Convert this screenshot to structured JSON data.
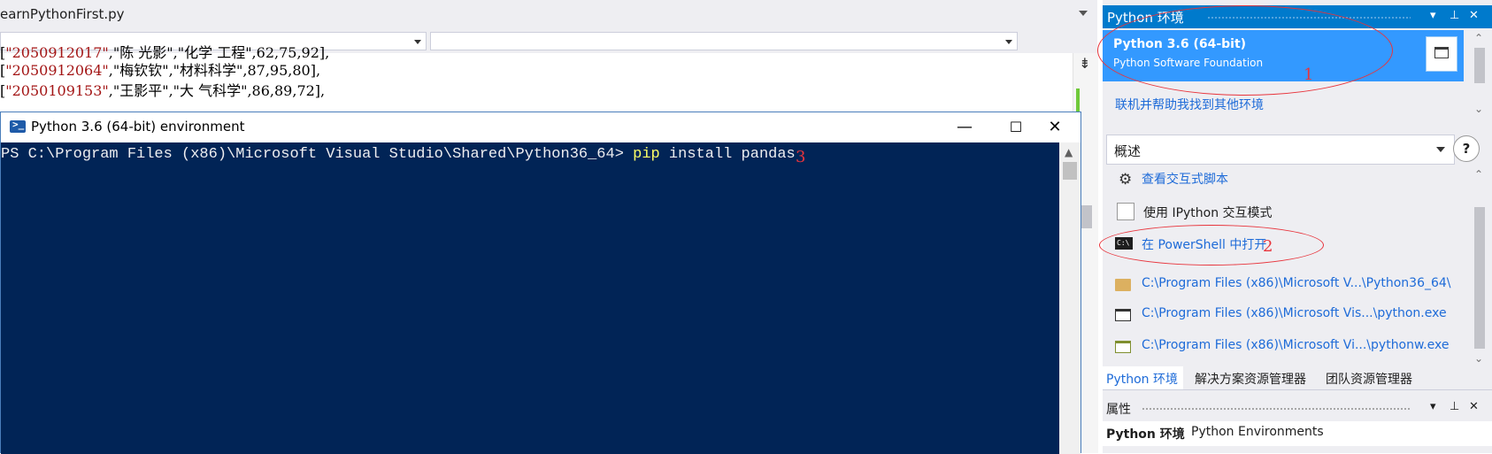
{
  "editor": {
    "file_tab": "earnPythonFirst.py",
    "code_lines": [
      {
        "pre": "[",
        "s": "\"2050912017\"",
        "post": ",\"陈 光影\",\"化学 工程\",62,75,92],"
      },
      {
        "pre": "[",
        "s": "\"2050912064\"",
        "post": ",\"梅钦钦\",\"材料科学\",87,95,80],"
      },
      {
        "pre": "[",
        "s": "\"2050109153\"",
        "post": ",\"王影平\",\"大 气科学\",86,89,72],"
      }
    ]
  },
  "ps_window": {
    "title": "Python 3.6 (64-bit) environment",
    "prompt_path": "PS C:\\Program Files (x86)\\Microsoft Visual Studio\\Shared\\Python36_64> ",
    "cmd": "pip",
    "args": " install pandas",
    "annotation": "3",
    "minimize": "—",
    "maximize": "☐",
    "close": "✕"
  },
  "py_panel": {
    "title": "Python 环境",
    "env_name": "Python 3.6 (64-bit)",
    "env_vendor": "Python Software Foundation",
    "annotation_1": "1",
    "find_more": "联机并帮助我找到其他环境",
    "overview_selected": "概述",
    "help": "?",
    "interactive_script": "查看交互式脚本",
    "ipython_label": "使用 IPython 交互模式",
    "open_powershell": "在 PowerShell 中打开",
    "annotation_2": "2",
    "paths": [
      "C:\\Program Files (x86)\\Microsoft V...\\Python36_64\\",
      "C:\\Program Files (x86)\\Microsoft Vis...\\python.exe",
      "C:\\Program Files (x86)\\Microsoft Vi...\\pythonw.exe"
    ],
    "bottom_tabs": [
      "Python 环境",
      "解决方案资源管理器",
      "团队资源管理器"
    ]
  },
  "properties": {
    "title": "属性",
    "name": "Python 环境",
    "value": "Python Environments"
  },
  "colors": {
    "accent": "#007acc",
    "ps_background": "#012456",
    "annotation": "#e8343c",
    "link": "#1e6bd8"
  }
}
